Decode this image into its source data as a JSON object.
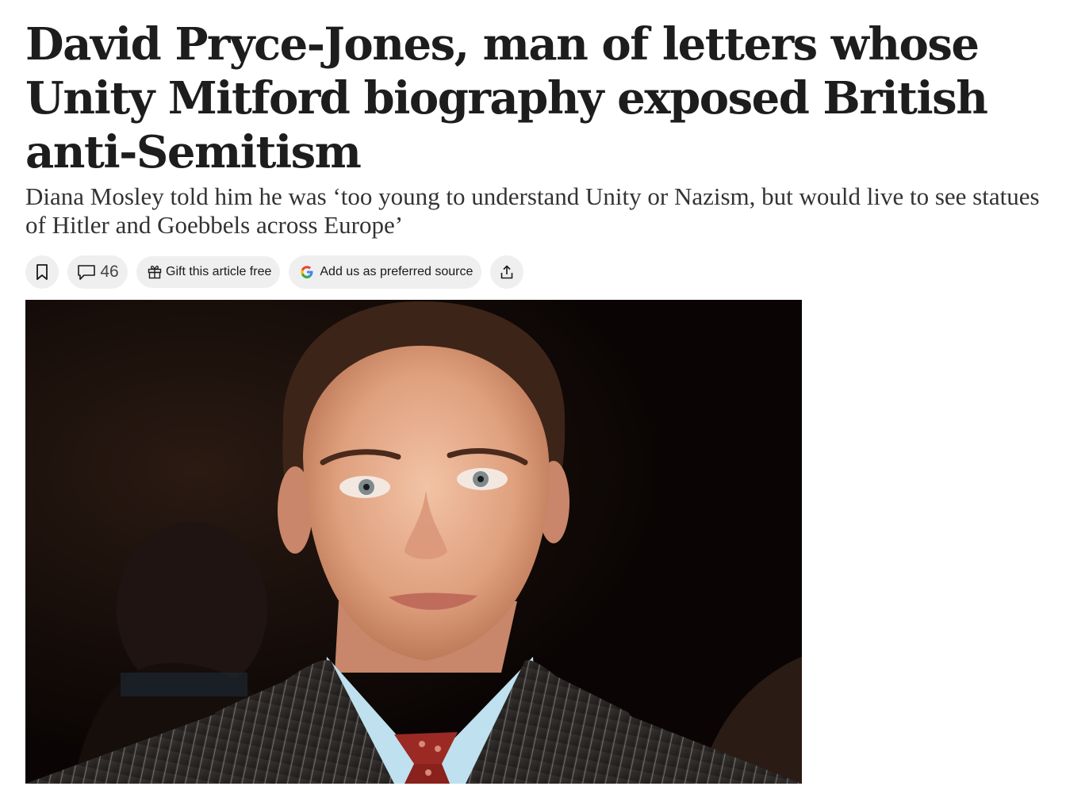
{
  "article": {
    "headline": "David Pryce-Jones, man of letters whose Unity Mitford biography exposed British anti-Semitism",
    "standfirst": "Diana Mosley told him he was ‘too young to understand Unity or Nazism, but would live to see statues of Hitler and Goebbels across Europe’"
  },
  "actions": {
    "bookmark_icon": "bookmark-icon",
    "comment_icon": "comment-icon",
    "comment_count": "46",
    "gift_icon": "gift-icon",
    "gift_label": "Gift this article free",
    "google_icon": "google-g-icon",
    "source_label": "Add us as preferred source",
    "share_icon": "share-icon"
  },
  "hero_image": {
    "subject": "portrait photograph of a man in a pinstripe suit and red patterned tie",
    "caption": ""
  },
  "colors": {
    "pill_background": "#efefef",
    "headline_text": "#1d1d1d",
    "standfirst_text": "#333333"
  }
}
